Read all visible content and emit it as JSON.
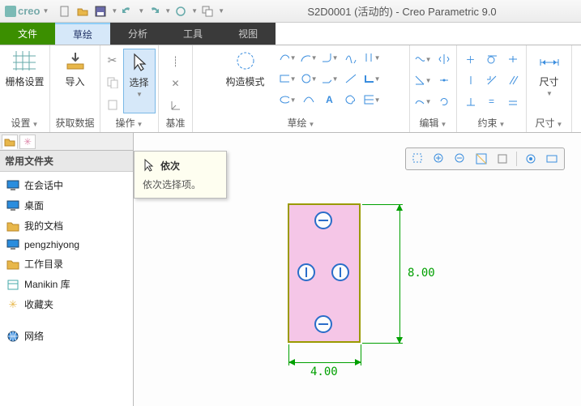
{
  "title": "S2D0001 (活动的) - Creo Parametric 9.0",
  "logo_text": "creo",
  "menu": {
    "file": "文件",
    "sketch": "草绘",
    "analysis": "分析",
    "tools": "工具",
    "view": "视图"
  },
  "ribbon": {
    "grid": {
      "label": "栅格设置",
      "title": "设置"
    },
    "import": {
      "label": "导入",
      "title": "获取数据"
    },
    "select": {
      "label": "选择",
      "title": "操作"
    },
    "datum": {
      "title": "基准"
    },
    "construct": {
      "label": "构造模式",
      "title": "草绘"
    },
    "edit": {
      "title": "编辑"
    },
    "constrain": {
      "title": "约束"
    },
    "dim": {
      "label": "尺寸",
      "title": "尺寸"
    }
  },
  "tooltip": {
    "header": "依次",
    "body": "依次选择项。"
  },
  "sidebar": {
    "header": "常用文件夹",
    "items": [
      {
        "icon": "monitor",
        "color": "#2a8dde",
        "label": "在会话中"
      },
      {
        "icon": "monitor",
        "color": "#2a8dde",
        "label": "桌面"
      },
      {
        "icon": "folder",
        "color": "#e8b74a",
        "label": "我的文档"
      },
      {
        "icon": "monitor",
        "color": "#2a8dde",
        "label": "pengzhiyong"
      },
      {
        "icon": "folder",
        "color": "#e8b74a",
        "label": "工作目录"
      },
      {
        "icon": "archive",
        "color": "#4aa",
        "label": "Manikin 库"
      },
      {
        "icon": "star",
        "color": "#e8b74a",
        "label": "收藏夹"
      },
      {
        "icon": "globe",
        "color": "#3a8dde",
        "label": "网络"
      }
    ]
  },
  "dims": {
    "width": "4.00",
    "height": "8.00"
  },
  "dd_glyph": "▼",
  "cut_glyph": "✂",
  "x_glyph": "✕",
  "xl_glyph": "✖",
  "plus_glyph": "＋"
}
